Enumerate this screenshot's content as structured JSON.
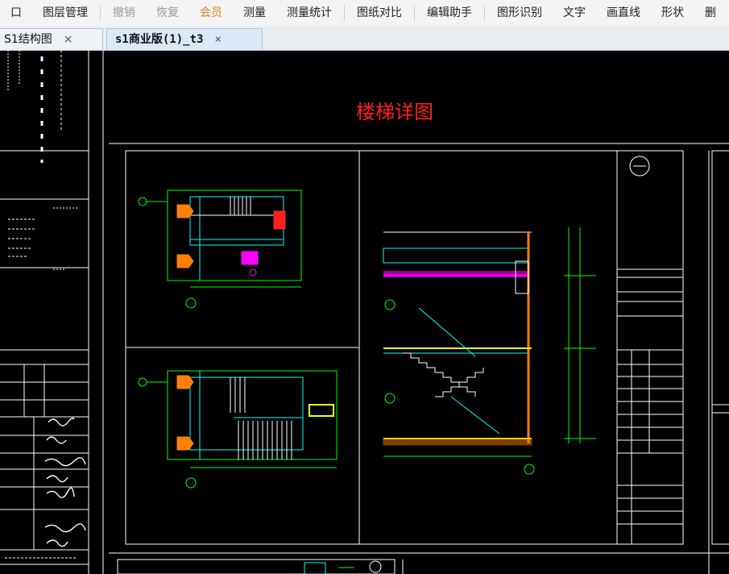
{
  "toolbar": {
    "items": [
      "口",
      "图层管理",
      "撤销",
      "恢复",
      "会员",
      "测量",
      "测量统计",
      "图纸对比",
      "编辑助手",
      "图形识别",
      "文字",
      "画直线",
      "形状",
      "删"
    ]
  },
  "tabs": [
    {
      "label": "S1结构图",
      "close": "×"
    },
    {
      "label": "s1商业版(1)_t3",
      "close": "×"
    }
  ],
  "drawing": {
    "title": "楼梯详图",
    "colors": {
      "title": "#ff2020",
      "frame": "#ffffff",
      "line": "#00ff00",
      "stair": "#00ffff",
      "highlight": "#ffff00",
      "slab": "#ff00ff",
      "fill": "#ff8000"
    }
  }
}
